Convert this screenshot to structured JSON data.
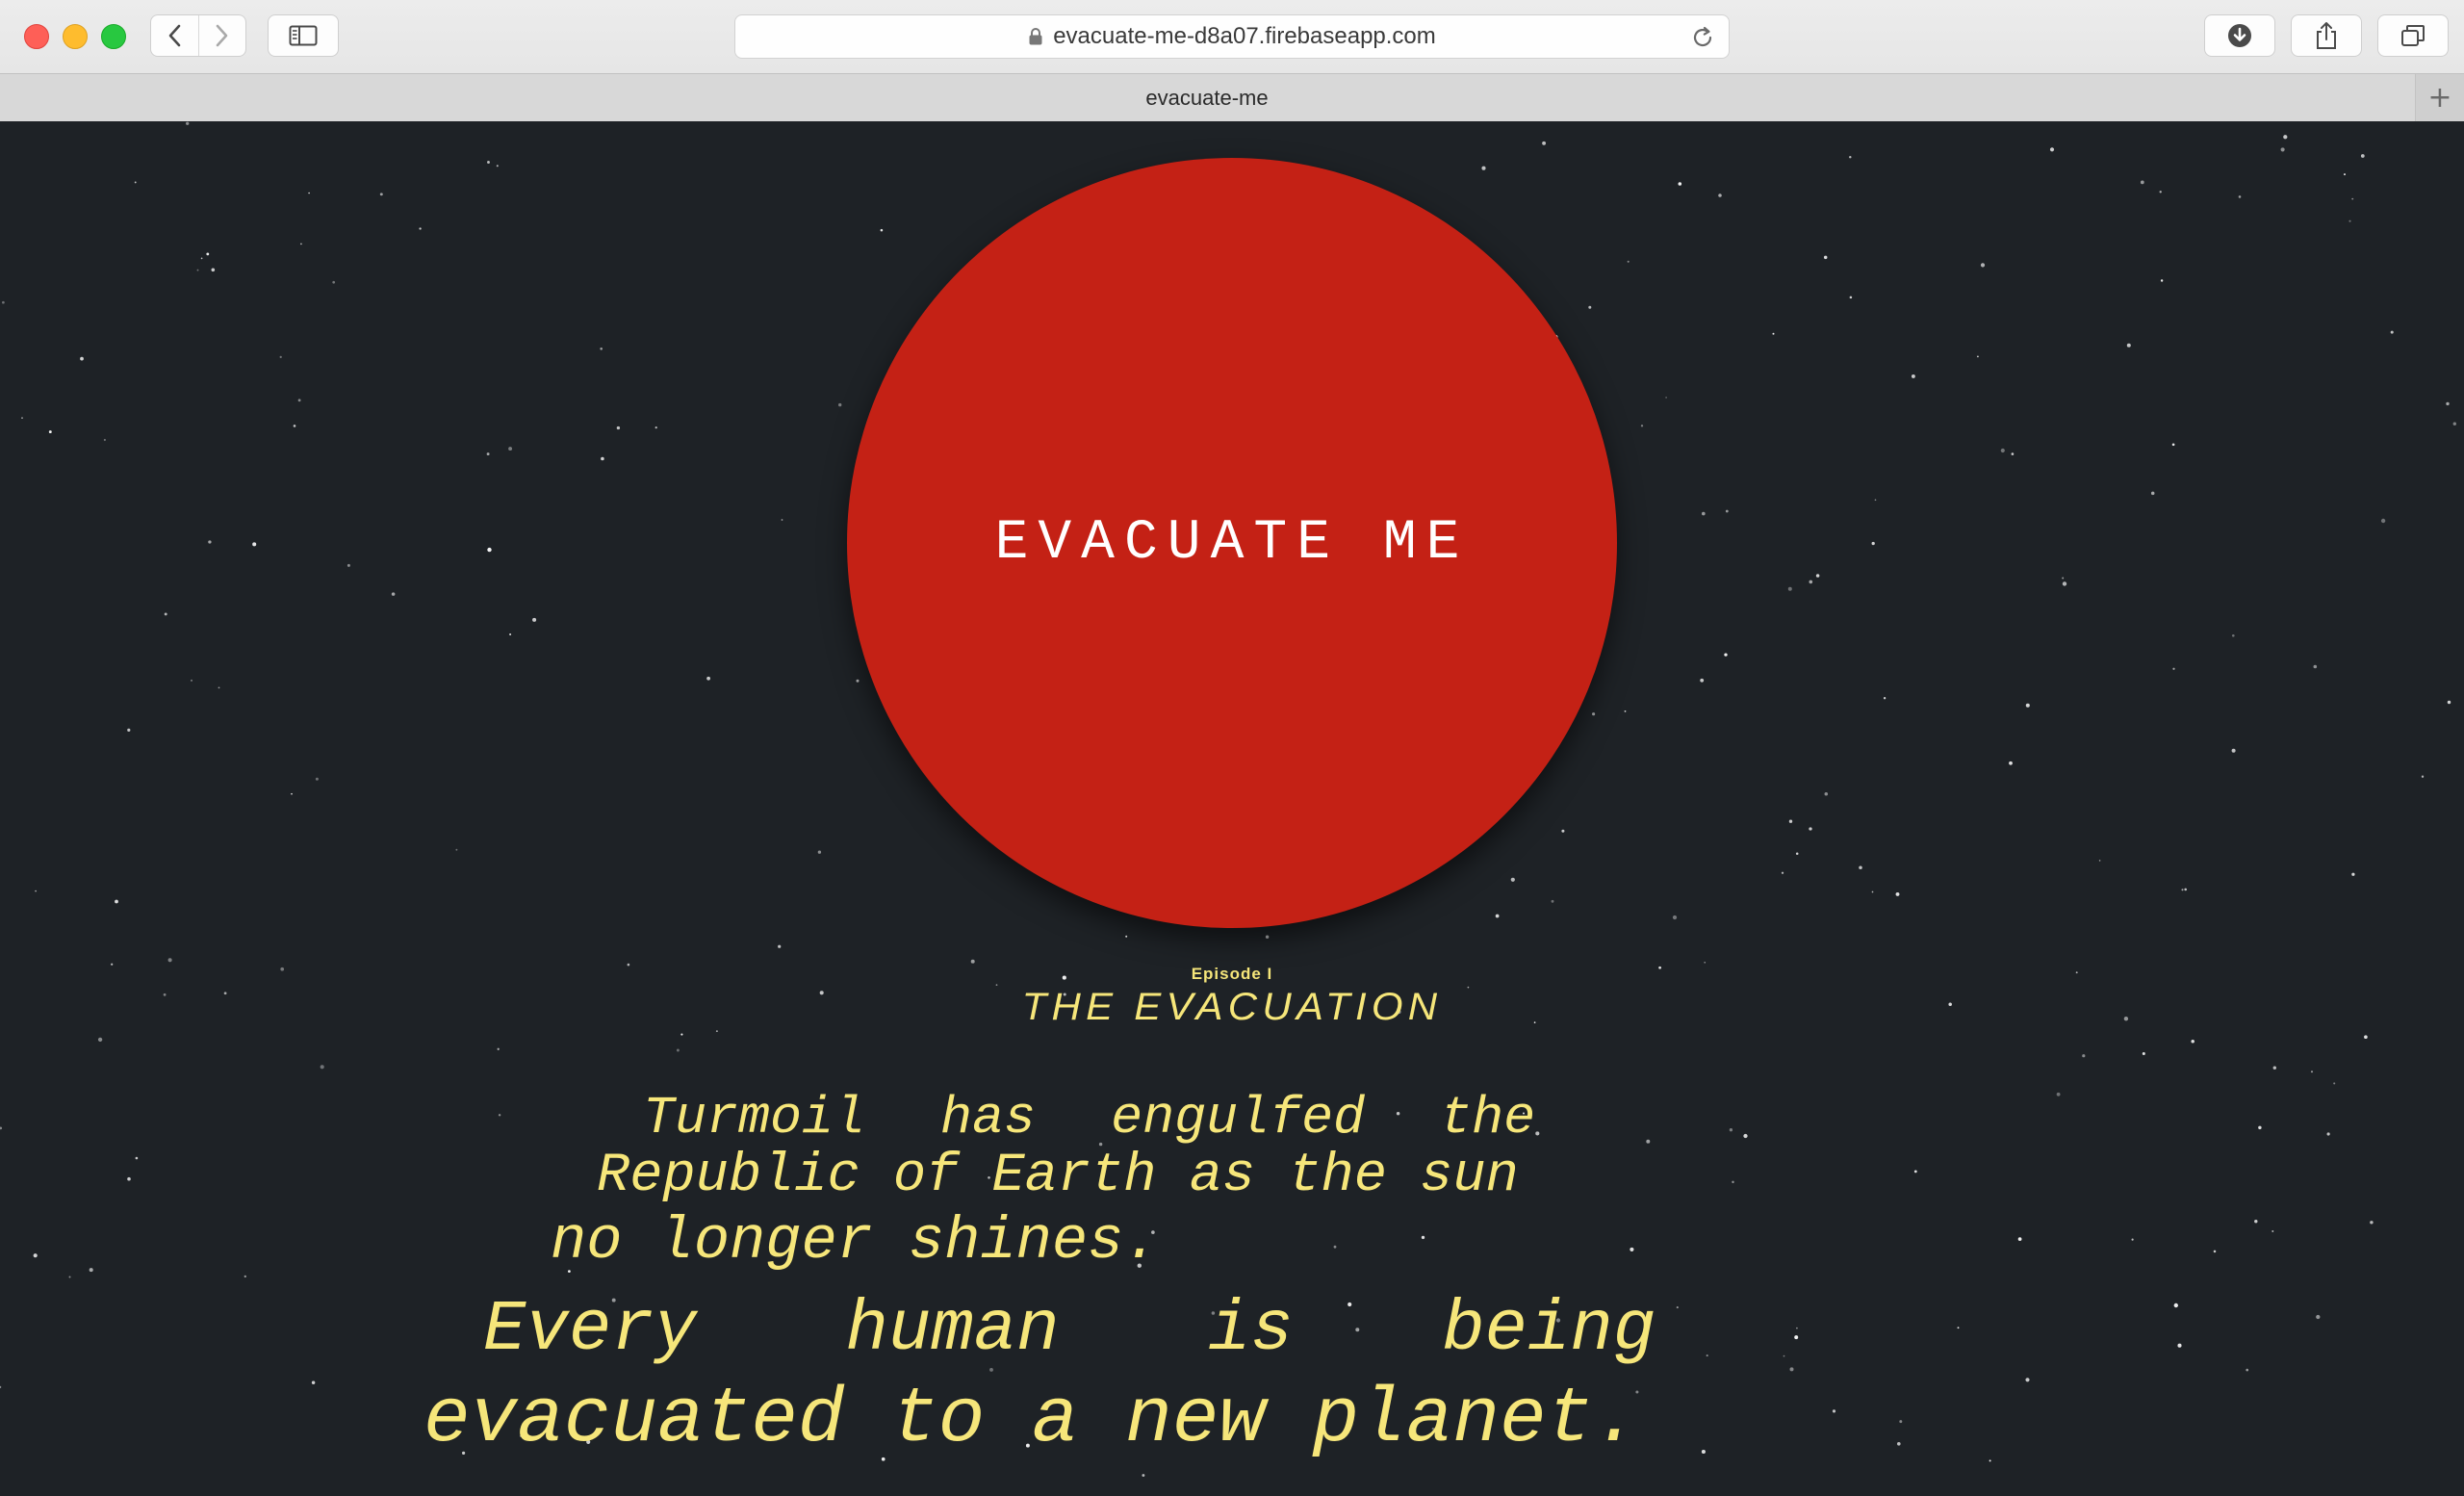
{
  "browser": {
    "url": "evacuate-me-d8a07.firebaseapp.com",
    "tab_title": "evacuate-me",
    "icons": {
      "back": "chevron-left-icon",
      "forward": "chevron-right-icon",
      "sidebar": "sidebar-icon",
      "lock": "lock-icon",
      "reload": "reload-icon",
      "downloads": "download-icon",
      "share": "share-icon",
      "tabs": "tabs-overview-icon",
      "new_tab": "plus-icon"
    },
    "new_tab_label": "+"
  },
  "page": {
    "button_label": "EVACUATE ME",
    "button_color": "#c42115",
    "background_color": "#1e2226",
    "crawl_color": "#f6e67a",
    "episode": "Episode I",
    "title": "THE EVACUATION",
    "crawl_lines": [
      "Turmoil has engulfed the",
      "Republic of Earth as the sun",
      "no longer shines.",
      "Every human is being",
      "evacuated to a new planet."
    ]
  }
}
